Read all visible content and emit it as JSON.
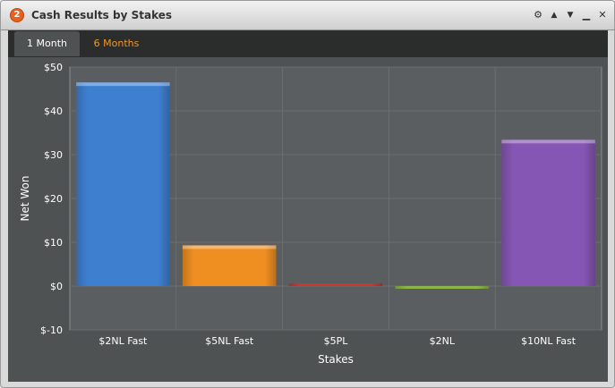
{
  "window": {
    "badge": "2",
    "title": "Cash Results by Stakes",
    "controls": [
      {
        "name": "settings-icon",
        "glyph": "⚙"
      },
      {
        "name": "move-up-icon",
        "glyph": "▲"
      },
      {
        "name": "move-down-icon",
        "glyph": "▼"
      },
      {
        "name": "minimize-icon",
        "glyph": "▁"
      },
      {
        "name": "close-icon",
        "glyph": "✕"
      }
    ]
  },
  "tabs": [
    {
      "label": "1 Month",
      "active": true
    },
    {
      "label": "6 Months",
      "active": false
    }
  ],
  "colors": {
    "active_tab_text": "#ffffff",
    "inactive_tab_text": "#f29a1f",
    "plot_background": "#5b5e60",
    "panel_background": "#4f5253"
  },
  "chart_data": {
    "type": "bar",
    "title": "",
    "xlabel": "Stakes",
    "ylabel": "Net Won",
    "ylim": [
      -10,
      50
    ],
    "yticks": [
      -10,
      0,
      10,
      20,
      30,
      40,
      50
    ],
    "ytick_labels": [
      "$-10",
      "$0",
      "$10",
      "$20",
      "$30",
      "$40",
      "$50"
    ],
    "grid": true,
    "categories": [
      "$2NL Fast",
      "$5NL Fast",
      "$5PL",
      "$2NL",
      "$10NL Fast"
    ],
    "values": [
      46.5,
      9.3,
      0.2,
      -0.6,
      33.4
    ],
    "bar_colors": [
      "#3f7fd0",
      "#ef8f22",
      "#c73a30",
      "#8ab64a",
      "#8556b3"
    ]
  }
}
